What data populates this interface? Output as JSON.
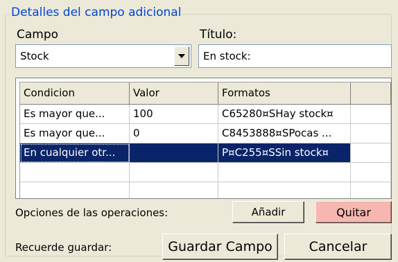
{
  "group": {
    "title": "Detalles del campo adicional"
  },
  "field": {
    "label": "Campo",
    "value": "Stock"
  },
  "title_field": {
    "label": "Título:",
    "value": "En stock:"
  },
  "grid": {
    "columns": [
      "Condicion",
      "Valor",
      "Formatos",
      ""
    ],
    "rows": [
      {
        "condition": "Es mayor que...",
        "value": "100",
        "format": "C65280¤SHay stock¤"
      },
      {
        "condition": "Es mayor que...",
        "value": "0",
        "format": "C8453888¤SPocas ..."
      },
      {
        "condition": "En cualquier otr...",
        "value": "",
        "format": "P¤C255¤SSin stock¤"
      }
    ],
    "selected_row": 2
  },
  "operations": {
    "label": "Opciones de las operaciones:",
    "add_label": "Añadir",
    "remove_label": "Quitar"
  },
  "footer": {
    "reminder_label": "Recuerde guardar:",
    "save_label": "Guardar Campo",
    "cancel_label": "Cancelar"
  },
  "colors": {
    "legend": "#0046d5",
    "selection": "#0a246a",
    "remove_button": "#f7b6b0",
    "background": "#ece9d8"
  },
  "icons": {
    "combo_arrow": "chevron-down-icon"
  }
}
